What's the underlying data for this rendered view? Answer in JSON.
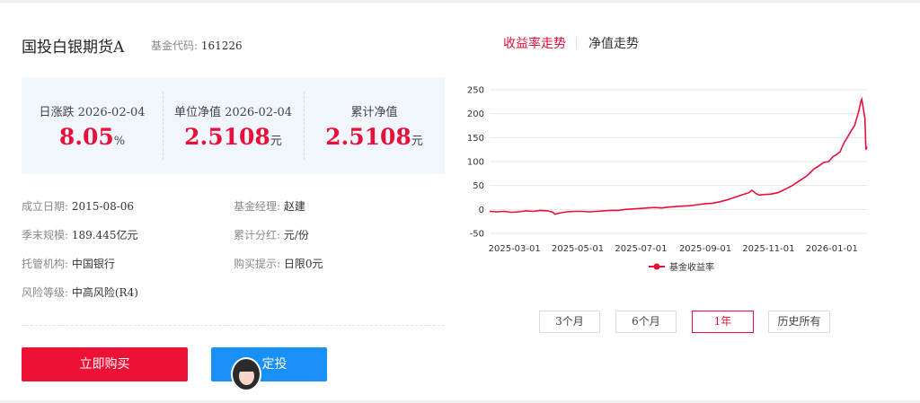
{
  "fund": {
    "name": "国投白银期货A",
    "code_label": "基金代码:",
    "code": "161226"
  },
  "nav": [
    {
      "label": "日涨跌 2026-02-04",
      "value": "8.05",
      "unit": "%"
    },
    {
      "label": "单位净值 2026-02-04",
      "value": "2.5108",
      "unit": "元"
    },
    {
      "label": "累计净值",
      "value": "2.5108",
      "unit": "元"
    }
  ],
  "info": {
    "established_label": "成立日期:",
    "established": "2015-08-06",
    "manager_label": "基金经理:",
    "manager": "赵建",
    "scale_label": "季末规模:",
    "scale": "189.445亿元",
    "dividend_label": "累计分红:",
    "dividend": "元/份",
    "custodian_label": "托管机构:",
    "custodian": "中国银行",
    "buy_tip_label": "购买提示:",
    "buy_tip": "日限0元",
    "risk_label": "风险等级:",
    "risk": "中高风险(R4)"
  },
  "buttons": {
    "buy": "立即购买",
    "sip": "定投"
  },
  "tabs": {
    "yield": "收益率走势",
    "nav": "净值走势"
  },
  "ranges": [
    "3个月",
    "6个月",
    "1年",
    "历史所有"
  ],
  "active_range": "1年",
  "colors": {
    "accent": "#e8103a",
    "sip_blue": "#1890f6",
    "nav_bg": "#f1f5fc"
  },
  "chart_data": {
    "type": "line",
    "ylim": [
      -50,
      250
    ],
    "yticks": [
      -50,
      0,
      50,
      100,
      150,
      200,
      250
    ],
    "xticks": [
      "2025-03-01",
      "2025-05-01",
      "2025-07-01",
      "2025-09-01",
      "2025-11-01",
      "2026-01-01"
    ],
    "grid": true,
    "legend_position": "bottom",
    "series": [
      {
        "name": "基金收益率",
        "color": "#e8103a",
        "x": [
          "2025-02-05",
          "2025-02-12",
          "2025-02-19",
          "2025-02-26",
          "2025-03-05",
          "2025-03-12",
          "2025-03-19",
          "2025-03-26",
          "2025-04-02",
          "2025-04-07",
          "2025-04-09",
          "2025-04-14",
          "2025-04-21",
          "2025-04-28",
          "2025-05-05",
          "2025-05-12",
          "2025-05-19",
          "2025-05-26",
          "2025-06-02",
          "2025-06-09",
          "2025-06-16",
          "2025-06-23",
          "2025-06-30",
          "2025-07-07",
          "2025-07-14",
          "2025-07-21",
          "2025-07-28",
          "2025-08-04",
          "2025-08-11",
          "2025-08-18",
          "2025-08-25",
          "2025-09-01",
          "2025-09-08",
          "2025-09-15",
          "2025-09-22",
          "2025-09-29",
          "2025-10-06",
          "2025-10-13",
          "2025-10-16",
          "2025-10-20",
          "2025-10-23",
          "2025-10-27",
          "2025-11-03",
          "2025-11-10",
          "2025-11-17",
          "2025-11-24",
          "2025-12-01",
          "2025-12-08",
          "2025-12-15",
          "2025-12-19",
          "2025-12-24",
          "2025-12-29",
          "2026-01-02",
          "2026-01-06",
          "2026-01-09",
          "2026-01-13",
          "2026-01-16",
          "2026-01-20",
          "2026-01-23",
          "2026-01-27",
          "2026-01-29",
          "2026-01-30",
          "2026-02-02",
          "2026-02-03",
          "2026-02-04"
        ],
        "values": [
          -4,
          -5,
          -4,
          -6,
          -5,
          -3,
          -4,
          -2,
          -3,
          -6,
          -10,
          -7,
          -5,
          -4,
          -4,
          -5,
          -4,
          -3,
          -2,
          -2,
          0,
          1,
          2,
          3,
          4,
          3,
          5,
          6,
          7,
          8,
          10,
          12,
          13,
          16,
          20,
          25,
          30,
          35,
          40,
          33,
          30,
          31,
          32,
          35,
          42,
          50,
          60,
          70,
          85,
          90,
          98,
          100,
          110,
          115,
          120,
          140,
          150,
          165,
          175,
          205,
          225,
          230,
          190,
          125,
          131
        ]
      }
    ]
  }
}
